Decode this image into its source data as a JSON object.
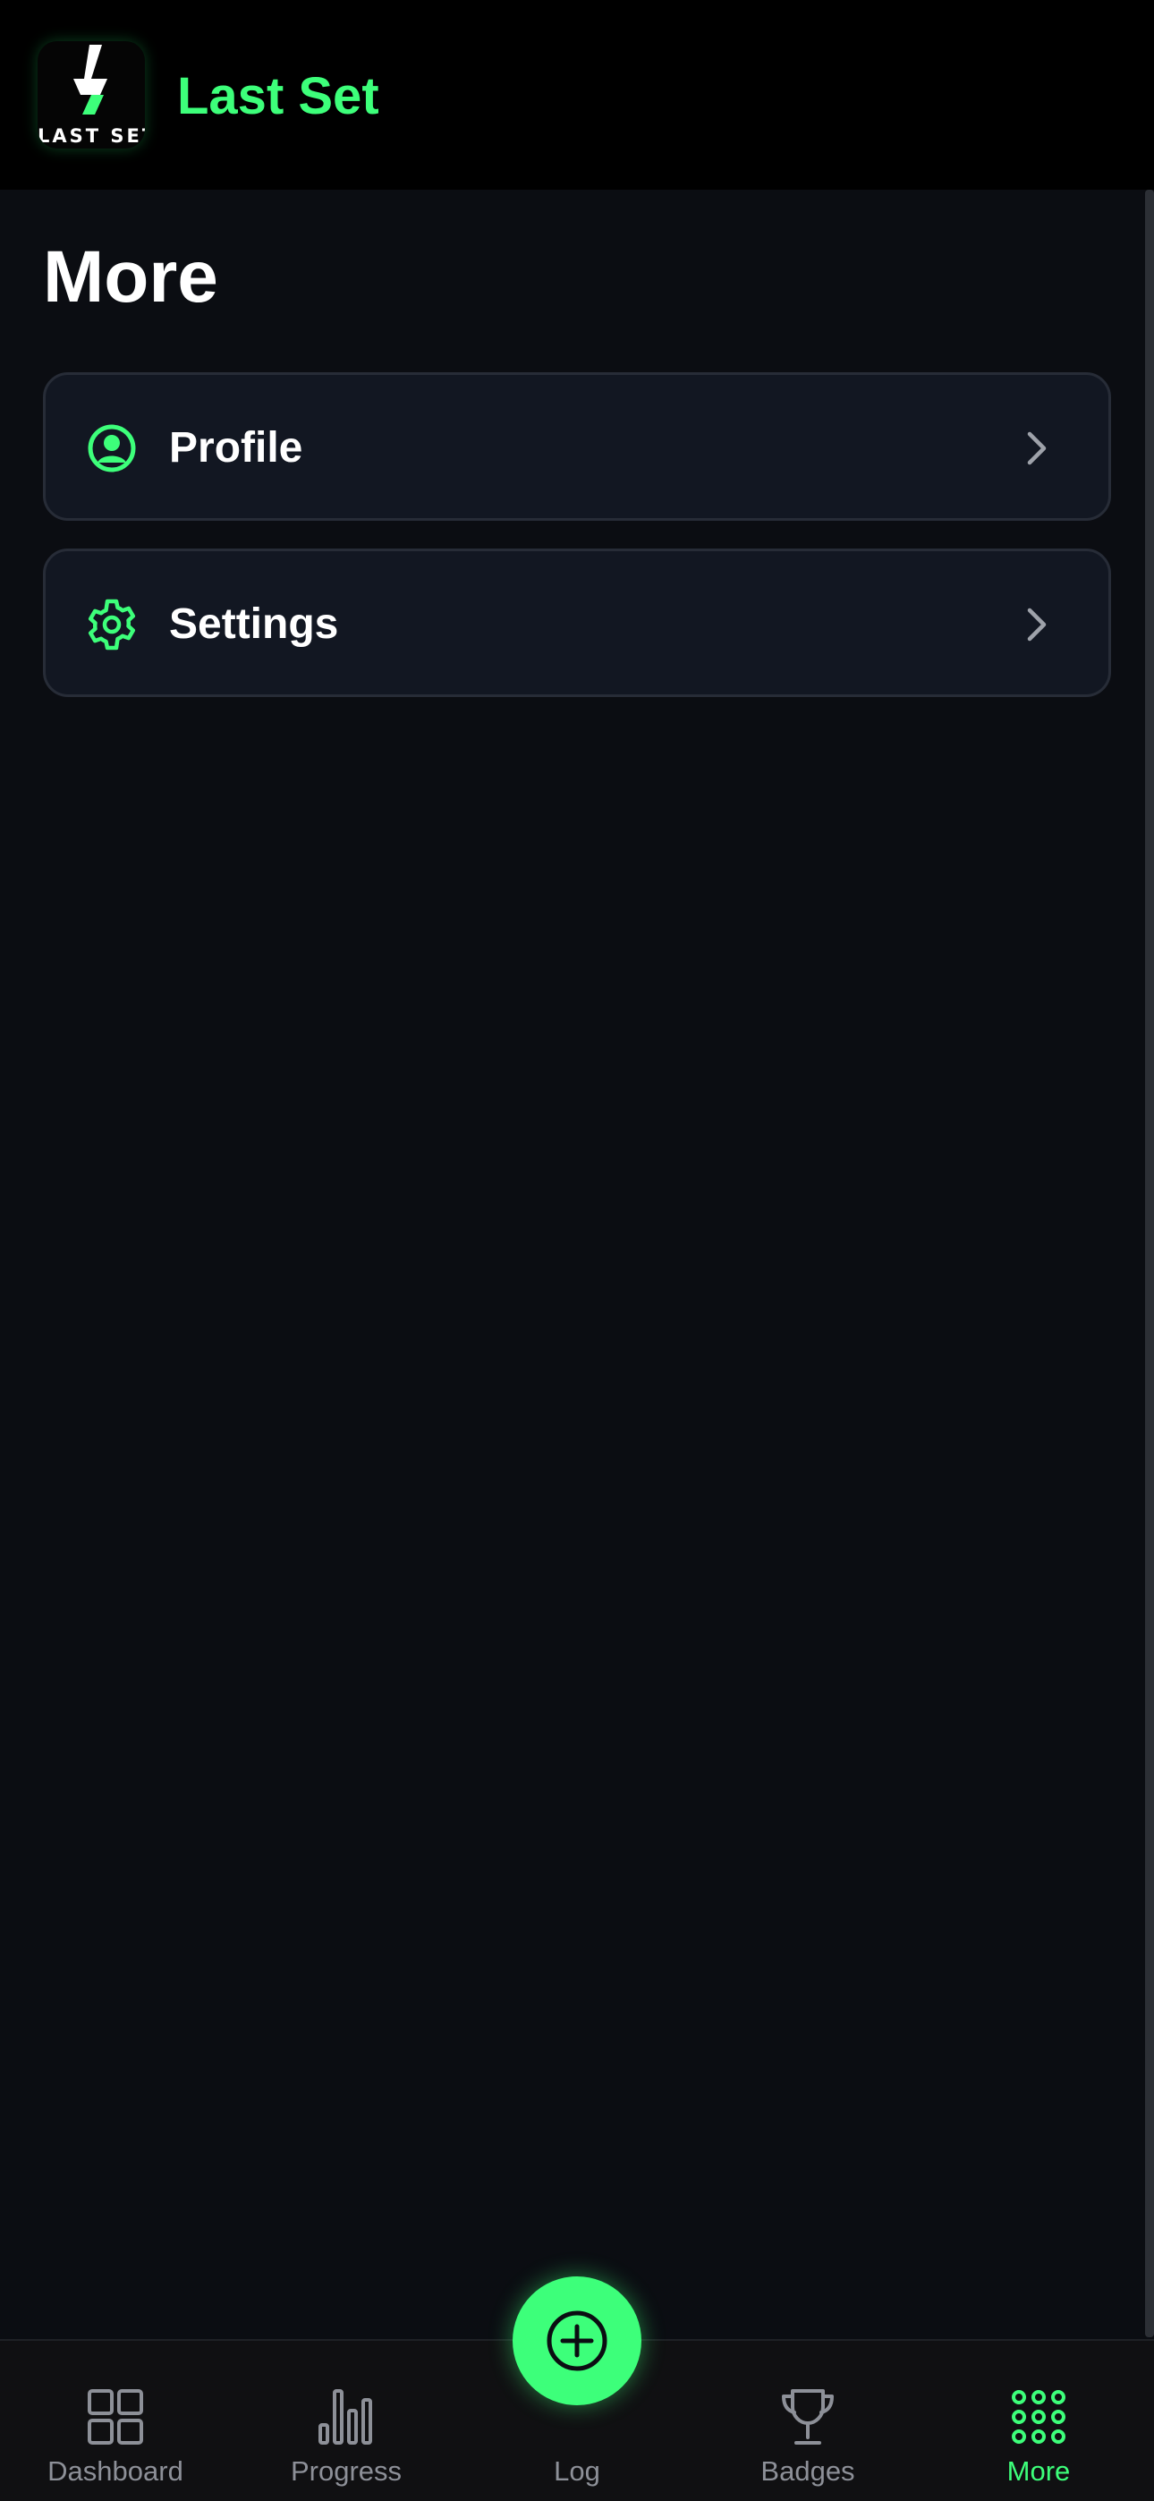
{
  "header": {
    "logo_text": "LAST SET",
    "title": "Last Set"
  },
  "page": {
    "title": "More"
  },
  "menu": [
    {
      "label": "Profile",
      "icon": "user-circle-icon"
    },
    {
      "label": "Settings",
      "icon": "gear-icon"
    }
  ],
  "nav": {
    "items": [
      {
        "label": "Dashboard",
        "icon": "grid-icon",
        "active": false
      },
      {
        "label": "Progress",
        "icon": "bar-chart-icon",
        "active": false
      },
      {
        "label": "Log",
        "icon": "plus-circle-icon",
        "active": false
      },
      {
        "label": "Badges",
        "icon": "trophy-icon",
        "active": false
      },
      {
        "label": "More",
        "icon": "dots-grid-icon",
        "active": true
      }
    ]
  },
  "colors": {
    "accent": "#3dff7a",
    "background": "#0b0d12",
    "card": "#121722",
    "inactive": "#8d9098"
  }
}
